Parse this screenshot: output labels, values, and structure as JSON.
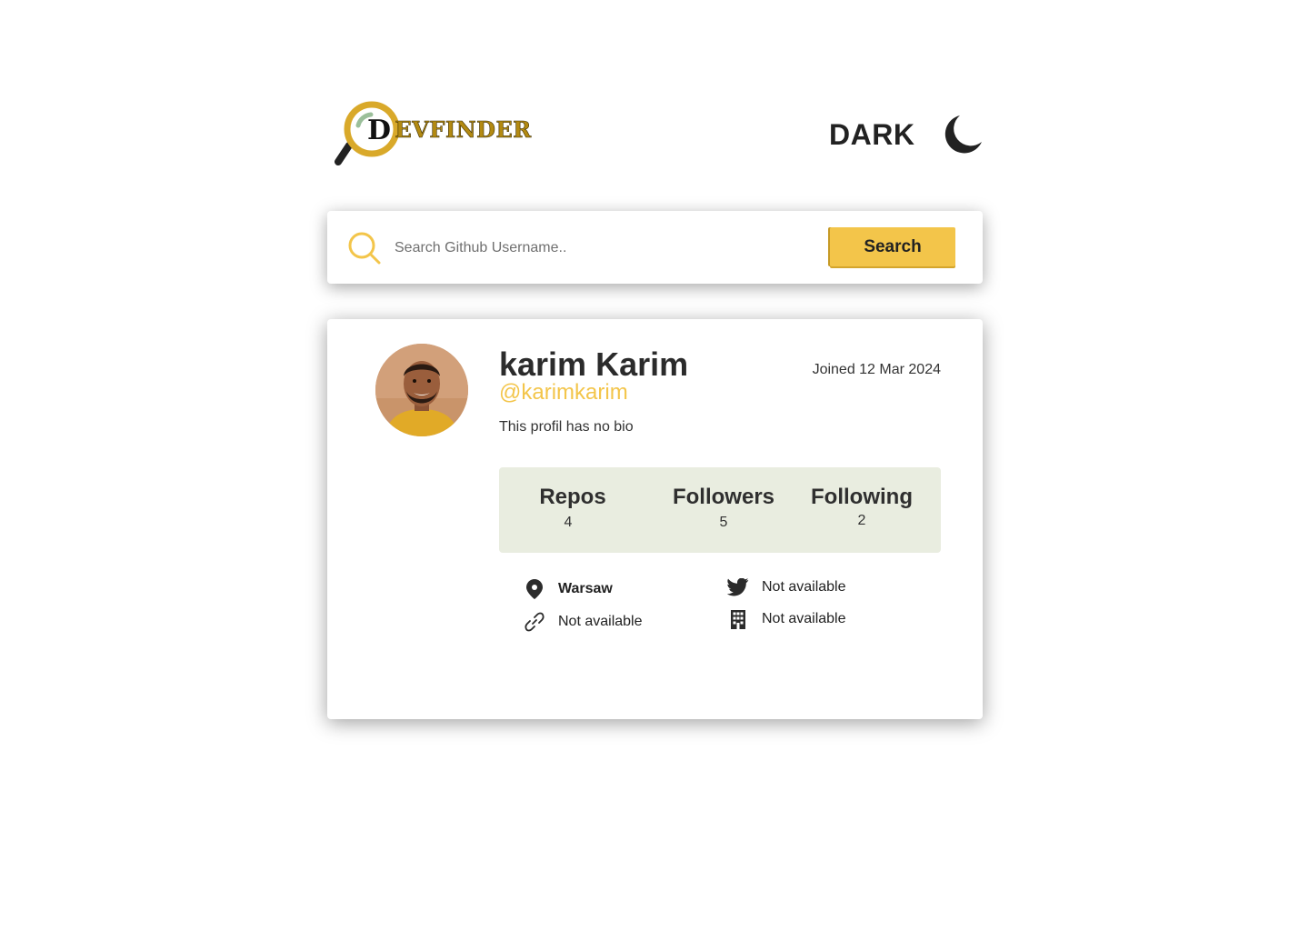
{
  "header": {
    "logo_letter": "D",
    "logo_rest": "EVFINDER",
    "mode_label": "DARK",
    "mode_icon": "moon-icon"
  },
  "search": {
    "placeholder": "Search Github Username..",
    "value": "",
    "button_label": "Search",
    "icon": "search-icon"
  },
  "profile": {
    "name": "karim Karim",
    "login": "@karimkarim",
    "joined": "Joined 12 Mar 2024",
    "bio": "This profil has no bio",
    "stats": [
      {
        "label": "Repos",
        "value": "4"
      },
      {
        "label": "Followers",
        "value": "5"
      },
      {
        "label": "Following",
        "value": "2"
      }
    ],
    "info": {
      "location": {
        "icon": "location-pin-icon",
        "text": "Warsaw"
      },
      "blog": {
        "icon": "link-icon",
        "text": "Not available"
      },
      "twitter": {
        "icon": "twitter-icon",
        "text": "Not available"
      },
      "company": {
        "icon": "building-icon",
        "text": "Not available"
      }
    }
  },
  "colors": {
    "accent": "#f3c54a",
    "stats_bg": "#e9ede0",
    "text": "#222222"
  }
}
